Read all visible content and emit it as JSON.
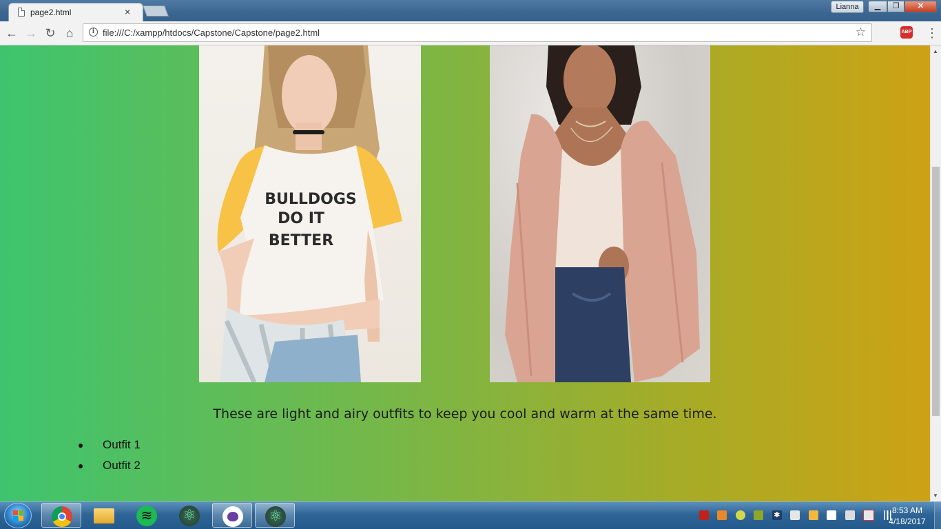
{
  "browser": {
    "tab_title": "page2.html",
    "tab_close": "×",
    "profile_name": "Lianna",
    "url": "file:///C:/xampp/htdocs/Capstone/Capstone/page2.html",
    "extension_label": "ABP"
  },
  "page": {
    "outfit1_shirt_line1": "BULLDOGS",
    "outfit1_shirt_line2": "DO IT",
    "outfit1_shirt_line3": "BETTER",
    "caption": "These are light and airy outfits to keep you cool and warm at the same time.",
    "list": [
      "Outfit 1",
      "Outfit 2"
    ]
  },
  "taskbar": {
    "time": "8:53 AM",
    "date": "4/18/2017",
    "apps": [
      "chrome-icon",
      "file-explorer-icon",
      "spotify-icon",
      "atom-icon",
      "github-desktop-icon",
      "atom-icon"
    ]
  },
  "colors": {
    "gradient_left": "#3ec46e",
    "gradient_right": "#cda214",
    "shirt_sleeve": "#f7c245",
    "cardigan": "#d9a592"
  }
}
